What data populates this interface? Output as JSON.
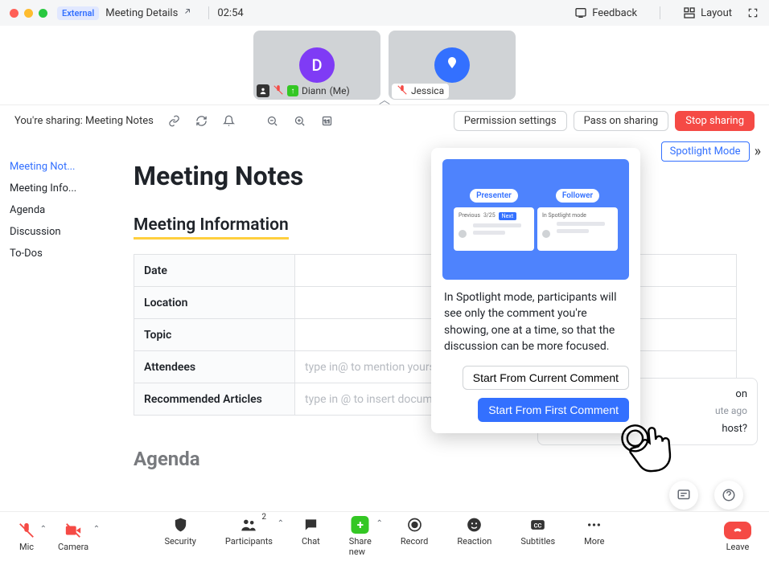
{
  "titlebar": {
    "external": "External",
    "title": "Meeting Details",
    "timer": "02:54",
    "feedback": "Feedback",
    "layout": "Layout"
  },
  "tiles": {
    "p1_initial": "D",
    "p1_name": "Diann",
    "p1_me": "(Me)",
    "p2_name": "Jessica"
  },
  "sharebar": {
    "text": "You're sharing: Meeting Notes",
    "perm": "Permission settings",
    "pass": "Pass on sharing",
    "stop": "Stop sharing"
  },
  "rail": {
    "spotlight": "Spotlight Mode"
  },
  "outline": [
    "Meeting Not...",
    "Meeting Info...",
    "Agenda",
    "Discussion",
    "To-Dos"
  ],
  "doc": {
    "title": "Meeting Notes",
    "section": "Meeting Information",
    "rows": [
      {
        "k": "Date",
        "v": ""
      },
      {
        "k": "Location",
        "v": ""
      },
      {
        "k": "Topic",
        "v": ""
      },
      {
        "k": "Attendees",
        "v": "type in@ to mention yours"
      },
      {
        "k": "Recommended Articles",
        "v": "type in @ to insert docum"
      }
    ],
    "agenda": "Agenda"
  },
  "behind": {
    "line1": "on",
    "line2": "ute ago",
    "line3": "host?"
  },
  "popover": {
    "presenter": "Presenter",
    "follower": "Follower",
    "prev": "Previous",
    "count": "3/25",
    "next": "Next",
    "inmode": "In Spotlight mode",
    "body": "In Spotlight mode, participants will see only the comment you're showing, one at a time, so that the discussion can be more focused.",
    "btn1": "Start From Current Comment",
    "btn2": "Start From First Comment"
  },
  "bottom": {
    "mic": "Mic",
    "camera": "Camera",
    "security": "Security",
    "participants": "Participants",
    "pcount": "2",
    "chat": "Chat",
    "sharenew": "Share new",
    "record": "Record",
    "reaction": "Reaction",
    "subtitles": "Subtitles",
    "more": "More",
    "leave": "Leave"
  }
}
